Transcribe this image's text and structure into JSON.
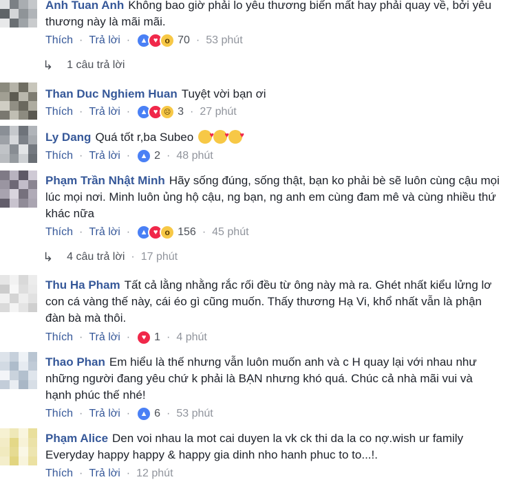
{
  "labels": {
    "like": "Thích",
    "reply": "Trả lời",
    "sep": "·"
  },
  "comments": [
    {
      "author": "Anh Tuan Anh",
      "text": "Không bao giờ phải lo yêu thương biến mất hay phải quay về, bởi yêu thương này là mãi mãi.",
      "reactions": [
        "like",
        "love",
        "wow"
      ],
      "count": "70",
      "time": "53 phút",
      "replies": "1 câu trả lời",
      "replies_time": "",
      "avatar_colors": [
        "#9aa0a6",
        "#cfd2d6",
        "#6d7378",
        "#b8bcc0",
        "#e0e2e4",
        "#7b8085",
        "#a9adb1",
        "#c4c7ca",
        "#5f6468",
        "#d4d6d8",
        "#8f9498",
        "#b0b4b8",
        "#e8e9ea",
        "#6a6f73",
        "#9ea3a7",
        "#c9cbcd"
      ]
    },
    {
      "author": "Than Duc Nghiem Huan",
      "text": "Tuyệt vời bạn ơi",
      "reactions": [
        "like",
        "love",
        "sad"
      ],
      "count": "3",
      "time": "27 phút",
      "avatar_colors": [
        "#8b8a7e",
        "#b5b3a8",
        "#6f6d62",
        "#c8c6bb",
        "#a19f93",
        "#5d5b52",
        "#bab8ad",
        "#7e7c71",
        "#d0cec4",
        "#918f84",
        "#6a685e",
        "#aeaca0",
        "#7a7870",
        "#c0beb3",
        "#8d8b80",
        "#5a5850"
      ]
    },
    {
      "author": "Ly Dang",
      "text": "Quá tốt r,ba Subeo",
      "emojis": 3,
      "reactions": [
        "like"
      ],
      "count": "2",
      "time": "48 phút",
      "avatar_colors": [
        "#8a8f96",
        "#c5c8cc",
        "#6e737a",
        "#b0b4b9",
        "#9da1a7",
        "#d6d8db",
        "#7c8188",
        "#a6aaaf",
        "#c0c3c7",
        "#888d93",
        "#e2e4e6",
        "#747980",
        "#b9bcc0",
        "#959a9f",
        "#cdd0d3",
        "#6a6f75"
      ]
    },
    {
      "author": "Phạm Trần Nhật Minh",
      "text": "Hãy sống đúng, sống thật, bạn ko phải bè sẽ luôn cùng cậu mọi lúc mọi nơi. Minh luôn ủng hộ cậu, ng bạn, ng anh em cùng đam mê và cùng nhiều thứ khác nữa",
      "reactions": [
        "like",
        "love",
        "wow"
      ],
      "count": "156",
      "time": "45 phút",
      "replies": "4 câu trả lời",
      "replies_time": "17 phút",
      "avatar_colors": [
        "#7f7a86",
        "#b8b3bf",
        "#5e5966",
        "#cfcad5",
        "#9a95a1",
        "#6e6976",
        "#c2bdc9",
        "#8a8591",
        "#a8a3af",
        "#d9d5de",
        "#76717d",
        "#b0abb7",
        "#635e6b",
        "#c8c3ce",
        "#918c98",
        "#aaa5b1"
      ]
    },
    {
      "author": "Thu Ha Pham",
      "text": "Tất cả lằng nhằng rắc rối đều từ ông này mà ra. Ghét nhất kiểu lửng lơ con cá vàng thế này, cái éo gì cũng muốn. Thấy thương Hạ Vi, khổ nhất vẫn là phận đàn bà mà thôi.",
      "reactions": [
        "love"
      ],
      "count": "1",
      "time": "4 phút",
      "avatar_colors": [
        "#e6e6e6",
        "#f2f2f2",
        "#d9d9d9",
        "#ececec",
        "#cccccc",
        "#f7f7f7",
        "#dedede",
        "#e9e9e9",
        "#f0f0f0",
        "#d4d4d4",
        "#eeeeee",
        "#e1e1e1",
        "#dadada",
        "#f4f4f4",
        "#e4e4e4",
        "#cfcfcf"
      ]
    },
    {
      "author": "Thao Phan",
      "text": "Em hiểu là thế nhưng vẫn luôn muốn anh và c H quay lại với nhau như những người đang yêu chứ k phải là BẠN nhưng khó quá. Chúc cả nhà mãi vui và hạnh phúc thế nhé!",
      "reactions": [
        "like"
      ],
      "count": "6",
      "time": "53 phút",
      "avatar_colors": [
        "#dde3ea",
        "#c6d0db",
        "#eef2f6",
        "#b9c5d2",
        "#d2dae3",
        "#aebccb",
        "#e6ebf1",
        "#c0cbd7",
        "#f3f5f8",
        "#cad3dd",
        "#b3c0ce",
        "#dfe5ec",
        "#c3cdd9",
        "#e9edf2",
        "#a9b7c6",
        "#d7dee6"
      ]
    },
    {
      "author": "Phạm Alice",
      "text": "Den voi nhau la mot cai duyen la vk ck thi da la co nợ.wish ur family Everyday happy happy & happy gia dinh nho hanh phuc to to...!.",
      "reactions": [],
      "count": "",
      "time": "12 phút",
      "avatar_colors": [
        "#f6f1d2",
        "#efe8b8",
        "#f9f5de",
        "#e9df9c",
        "#f3ecc6",
        "#e4d888",
        "#f7f2d7",
        "#ebe2a8",
        "#f1eabf",
        "#e6db92",
        "#faf7e5",
        "#ede5b0",
        "#f4eecb",
        "#e2d580",
        "#f8f4dc",
        "#ebe1a2"
      ]
    }
  ]
}
